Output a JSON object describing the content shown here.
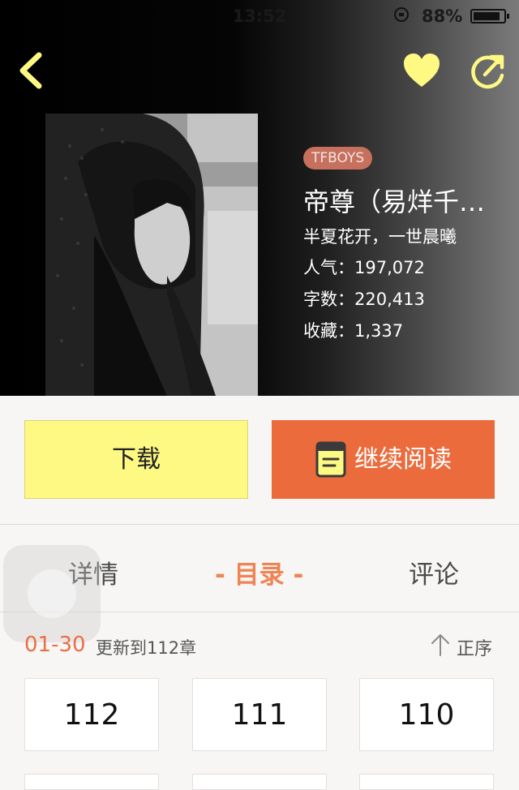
{
  "status_bar": {
    "time": "13:52",
    "battery_percent": "88%",
    "battery_level": 0.88
  },
  "header": {
    "back_icon": "chevron-left-icon",
    "favorite_icon": "heart-icon",
    "share_icon": "share-icon",
    "icon_color": "#fef983"
  },
  "book": {
    "tag": "TFBOYS",
    "title": "帝尊（易烊千…",
    "author": "半夏花开，一世晨曦",
    "popularity": "人气：197,072",
    "word_count": "字数：220,413",
    "favorites": "收藏：1,337"
  },
  "actions": {
    "download_label": "下载",
    "continue_label": "继续阅读",
    "book_icon": "book-icon"
  },
  "tabs": [
    {
      "label": "详情",
      "active": false
    },
    {
      "label": "- 目录 -",
      "active": true
    },
    {
      "label": "评论",
      "active": false
    }
  ],
  "toc": {
    "range": "01-30",
    "update": "更新到112章",
    "sort_label": "正序",
    "sort_icon": "arrow-up-icon",
    "chapters": [
      "112",
      "111",
      "110"
    ]
  },
  "colors": {
    "accent_orange": "#eb6b3d",
    "accent_yellow": "#fef983",
    "tab_active": "#ef8452"
  }
}
